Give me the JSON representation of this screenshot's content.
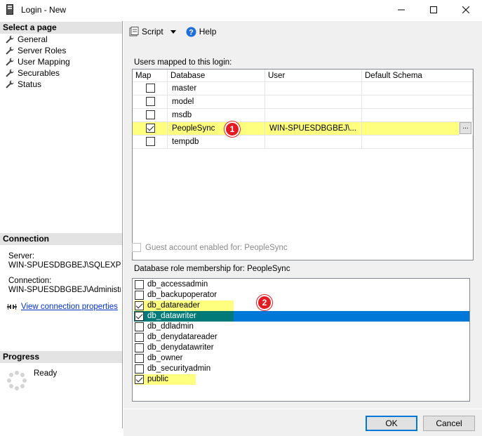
{
  "window": {
    "title": "Login - New"
  },
  "left": {
    "select_page_header": "Select a page",
    "pages": [
      {
        "label": "General",
        "icon": "wrench-icon"
      },
      {
        "label": "Server Roles",
        "icon": "wrench-icon"
      },
      {
        "label": "User Mapping",
        "icon": "wrench-icon"
      },
      {
        "label": "Securables",
        "icon": "wrench-icon"
      },
      {
        "label": "Status",
        "icon": "wrench-icon"
      }
    ],
    "connection_header": "Connection",
    "server_label": "Server:",
    "server_value": "WIN-SPUESDBGBEJ\\SQLEXPRE",
    "connection_label": "Connection:",
    "connection_value": "WIN-SPUESDBGBEJ\\Administrato",
    "view_connection": "View connection properties",
    "progress_header": "Progress",
    "progress_status": "Ready"
  },
  "toolbar": {
    "script": "Script",
    "help": "Help"
  },
  "mapping": {
    "label": "Users mapped to this login:",
    "columns": [
      "Map",
      "Database",
      "User",
      "Default Schema"
    ],
    "rows": [
      {
        "map": false,
        "database": "master",
        "user": "",
        "schema": ""
      },
      {
        "map": false,
        "database": "model",
        "user": "",
        "schema": ""
      },
      {
        "map": false,
        "database": "msdb",
        "user": "",
        "schema": ""
      },
      {
        "map": true,
        "database": "PeopleSync",
        "user": "WIN-SPUESDBGBEJ\\...",
        "schema": "",
        "highlighted": true
      },
      {
        "map": false,
        "database": "tempdb",
        "user": "",
        "schema": ""
      }
    ],
    "ellipsis": "..."
  },
  "guest": {
    "label": "Guest account enabled for: PeopleSync",
    "checked": false
  },
  "roles": {
    "label": "Database role membership for: PeopleSync",
    "items": [
      {
        "label": "db_accessadmin",
        "checked": false
      },
      {
        "label": "db_backupoperator",
        "checked": false
      },
      {
        "label": "db_datareader",
        "checked": true
      },
      {
        "label": "db_datawriter",
        "checked": true
      },
      {
        "label": "db_ddladmin",
        "checked": false
      },
      {
        "label": "db_denydatareader",
        "checked": false
      },
      {
        "label": "db_denydatawriter",
        "checked": false
      },
      {
        "label": "db_owner",
        "checked": false
      },
      {
        "label": "db_securityadmin",
        "checked": false
      },
      {
        "label": "public",
        "checked": true
      }
    ]
  },
  "badges": {
    "one": "1",
    "two": "2"
  },
  "buttons": {
    "ok": "OK",
    "cancel": "Cancel"
  },
  "colors": {
    "highlight": "#ffff7f",
    "selection": "#0078d7",
    "badge": "#e31b23",
    "link": "#0033cc"
  }
}
